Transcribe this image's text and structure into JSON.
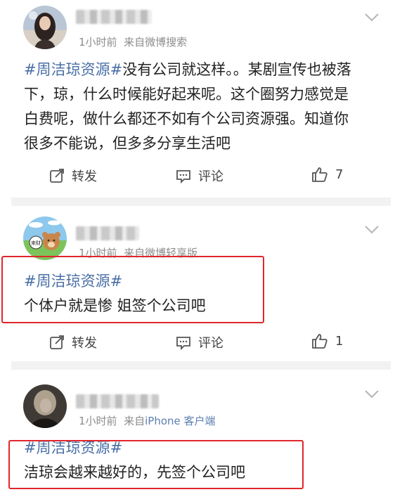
{
  "posts": [
    {
      "time": "1小时前",
      "source": "来自微博搜索",
      "topic": "#周洁琼资源#",
      "lines": [
        "没有公司就这样。。某剧宣传也被落",
        "下，琼，什么时候能好起来呢。这个圈努力感觉是",
        "白费呢，做什么都还不如有个公司资源强。知道你",
        "很多不能说，但多多分享生活吧"
      ],
      "repost_label": "转发",
      "comment_label": "评论",
      "like_count": "7"
    },
    {
      "time": "1小时前",
      "source": "来自微博轻享版",
      "avatar_text": "来财",
      "topic": "#周洁琼资源#",
      "lines": [
        "个体户就是惨 姐签个公司吧"
      ],
      "repost_label": "转发",
      "comment_label": "评论",
      "like_count": "1"
    },
    {
      "time": "1小时前",
      "source_prefix": "来自",
      "source_device": "iPhone 客户端",
      "topic": "#周洁琼资源#",
      "lines": [
        "洁琼会越来越好的，先签个公司吧"
      ]
    }
  ],
  "colors": {
    "topic": "#4a6fa5",
    "highlight_box": "#e0262b",
    "meta": "#8c8c8c"
  }
}
